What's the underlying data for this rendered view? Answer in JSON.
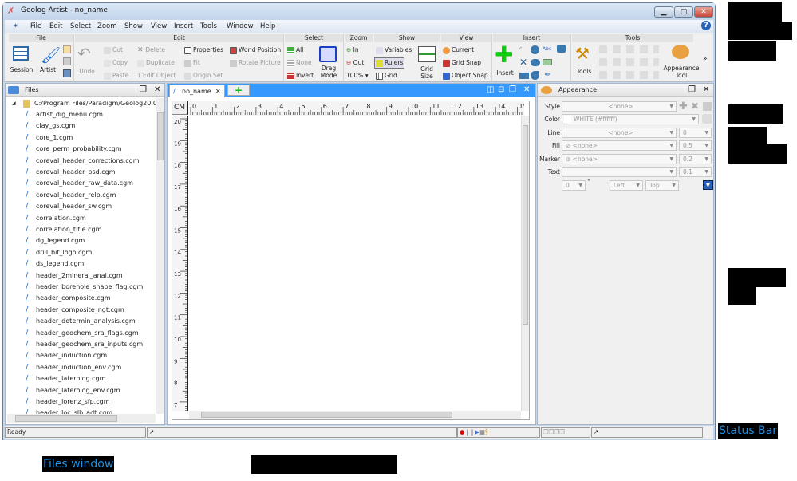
{
  "window": {
    "title": "Geolog Artist - no_name",
    "minimize": "▁",
    "maximize": "▢",
    "close": "✕",
    "help": "?"
  },
  "menu": [
    "File",
    "Edit",
    "Select",
    "Zoom",
    "Show",
    "View",
    "Insert",
    "Tools",
    "Window",
    "Help"
  ],
  "ribbon": {
    "file": {
      "title": "File",
      "session": "Session",
      "artist": "Artist"
    },
    "edit": {
      "title": "Edit",
      "undo": "Undo",
      "cut": "Cut",
      "copy": "Copy",
      "paste": "Paste",
      "delete": "Delete",
      "duplicate": "Duplicate",
      "edit_object": "Edit Object",
      "properties": "Properties",
      "fit": "Fit",
      "origin_set": "Origin Set",
      "world_position": "World Position",
      "rotate_picture": "Rotate Picture"
    },
    "select": {
      "title": "Select",
      "all": "All",
      "none": "None",
      "invert": "Invert",
      "drag_mode": "Drag Mode"
    },
    "zoom": {
      "title": "Zoom",
      "in": "In",
      "out": "Out",
      "level": "100%"
    },
    "show": {
      "title": "Show",
      "variables": "Variables",
      "rulers": "Rulers",
      "grid": "Grid",
      "grid_size": "Grid Size"
    },
    "view": {
      "title": "View",
      "current": "Current",
      "grid_snap": "Grid Snap",
      "object_snap": "Object Snap"
    },
    "insert": {
      "title": "Insert",
      "insert": "Insert",
      "abc": "Abc"
    },
    "tools": {
      "title": "Tools",
      "tools": "Tools",
      "appearance_tool": "Appearance Tool",
      "more": "»"
    }
  },
  "files_panel": {
    "title": "Files",
    "root": "C:/Program Files/Paradigm/Geolog20.0/",
    "items": [
      "artist_dig_menu.cgm",
      "clay_gs.cgm",
      "core_1.cgm",
      "core_perm_probability.cgm",
      "coreval_header_corrections.cgm",
      "coreval_header_psd.cgm",
      "coreval_header_raw_data.cgm",
      "coreval_header_relp.cgm",
      "coreval_header_sw.cgm",
      "correlation.cgm",
      "correlation_title.cgm",
      "dg_legend.cgm",
      "drill_bit_logo.cgm",
      "ds_legend.cgm",
      "header_2mineral_anal.cgm",
      "header_borehole_shape_flag.cgm",
      "header_composite.cgm",
      "header_composite_ngt.cgm",
      "header_determin_analysis.cgm",
      "header_geochem_sra_flags.cgm",
      "header_geochem_sra_inputs.cgm",
      "header_induction.cgm",
      "header_induction_env.cgm",
      "header_laterolog.cgm",
      "header_laterolog_env.cgm",
      "header_lorenz_sfp.cgm",
      "header_loc_slb_adt.cgm"
    ]
  },
  "document": {
    "tab": "no_name",
    "new_tab": "+",
    "unit": "CM",
    "h_ruler": [
      "0",
      "1",
      "2",
      "3",
      "4",
      "5",
      "6",
      "7",
      "8",
      "9",
      "10",
      "11",
      "12",
      "13",
      "14",
      "15"
    ],
    "v_ruler": [
      "20",
      "19",
      "18",
      "17",
      "16",
      "15",
      "14",
      "13",
      "12",
      "11",
      "10",
      "9",
      "8",
      "7"
    ]
  },
  "appearance": {
    "title": "Appearance",
    "rows": [
      {
        "label": "Style",
        "value": "<none>"
      },
      {
        "label": "Color",
        "value": "WHITE (#ffffff)"
      },
      {
        "label": "Line",
        "value": "<none>",
        "size": "0"
      },
      {
        "label": "Fill",
        "value": "<none>",
        "size": "0.5"
      },
      {
        "label": "Marker",
        "value": "<none>",
        "size": "0.2"
      },
      {
        "label": "Text",
        "value": "",
        "size": "0.1"
      }
    ],
    "angle": "0",
    "degree": "°",
    "h_align": "Left",
    "v_align": "Top"
  },
  "status": {
    "text": "Ready"
  },
  "callouts": {
    "files_window": "Files window",
    "status_bar": "Status Bar"
  },
  "colors": {
    "accent": "#3399ff",
    "title_bg": "#c4d6ec",
    "callout_text": "#1e8fe0"
  }
}
